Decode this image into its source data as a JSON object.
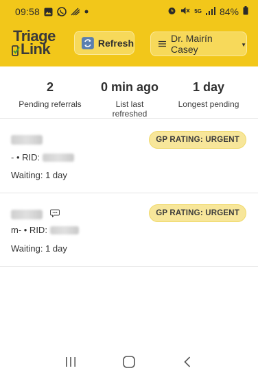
{
  "status_bar": {
    "time": "09:58",
    "battery": "84%",
    "network": "5G"
  },
  "header": {
    "logo_line1": "Triage",
    "logo_line2": "Link",
    "refresh_label": "Refresh",
    "user_label": "Dr. Mairín Casey",
    "brand_color": "#f2c71a"
  },
  "stats": [
    {
      "value": "2",
      "label": "Pending referrals"
    },
    {
      "value": "0 min ago",
      "label": "List last refreshed"
    },
    {
      "value": "1 day",
      "label": "Longest pending"
    }
  ],
  "referrals": [
    {
      "rid_prefix": "- • RID:",
      "waiting": "Waiting: 1 day",
      "badge": "GP RATING: URGENT",
      "has_comment": false
    },
    {
      "rid_prefix": "m- • RID:",
      "waiting": "Waiting: 1 day",
      "badge": "GP RATING: URGENT",
      "has_comment": true
    }
  ]
}
